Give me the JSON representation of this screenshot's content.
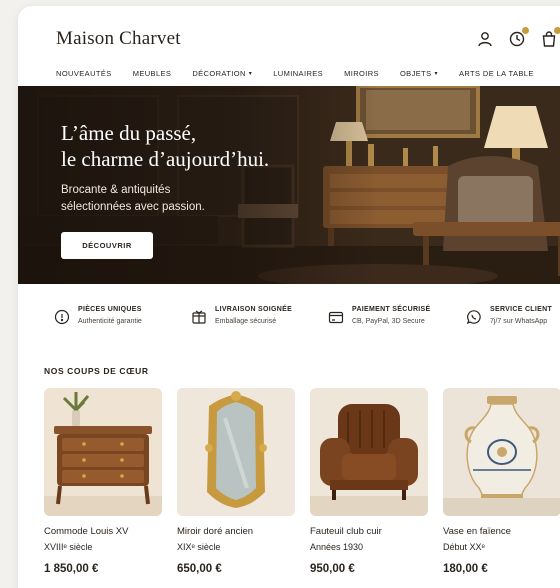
{
  "brand": "Maison Charvet",
  "header_icons": [
    "user-icon",
    "clock-icon",
    "bag-icon"
  ],
  "nav": [
    {
      "label": "NOUVEAUTÉS",
      "has_dropdown": false
    },
    {
      "label": "MEUBLES",
      "has_dropdown": false
    },
    {
      "label": "DÉCORATION",
      "has_dropdown": true
    },
    {
      "label": "LUMINAIRES",
      "has_dropdown": false
    },
    {
      "label": "MIROIRS",
      "has_dropdown": false
    },
    {
      "label": "OBJETS",
      "has_dropdown": true
    },
    {
      "label": "ARTS DE LA TABLE",
      "has_dropdown": false
    }
  ],
  "hero": {
    "title_line1": "L’âme du passé,",
    "title_line2": "le charme d’aujourd’hui.",
    "subtitle_line1": "Brocante & antiquités",
    "subtitle_line2": "sélectionnées avec passion.",
    "cta": "DÉCOUVRIR"
  },
  "features": [
    {
      "icon": "diamond-icon",
      "title": "PIÈCES UNIQUES",
      "desc": "Authenticité garantie"
    },
    {
      "icon": "gift-box-icon",
      "title": "LIVRAISON SOIGNÉE",
      "desc": "Emballage sécurisé"
    },
    {
      "icon": "card-icon",
      "title": "PAIEMENT SÉCURISÉ",
      "desc": "CB, PayPal, 3D Secure"
    },
    {
      "icon": "chat-icon",
      "title": "SERVICE CLIENT",
      "desc": "7j/7 sur WhatsApp"
    }
  ],
  "section_title": "NOS COUPS DE CŒUR",
  "products": [
    {
      "name": "Commode Louis XV",
      "period": "XVIIIᵉ siècle",
      "price": "1 850,00 €",
      "image": "commode"
    },
    {
      "name": "Miroir doré ancien",
      "period": "XIXᵉ siècle",
      "price": "650,00 €",
      "image": "mirror"
    },
    {
      "name": "Fauteuil club cuir",
      "period": "Années 1930",
      "price": "950,00 €",
      "image": "armchair"
    },
    {
      "name": "Vase en faïence",
      "period": "Début XXᵉ",
      "price": "180,00 €",
      "image": "vase"
    }
  ],
  "colors": {
    "accent": "#c89b3c",
    "text": "#2a241f",
    "hero_dark": "#2b1f15"
  }
}
